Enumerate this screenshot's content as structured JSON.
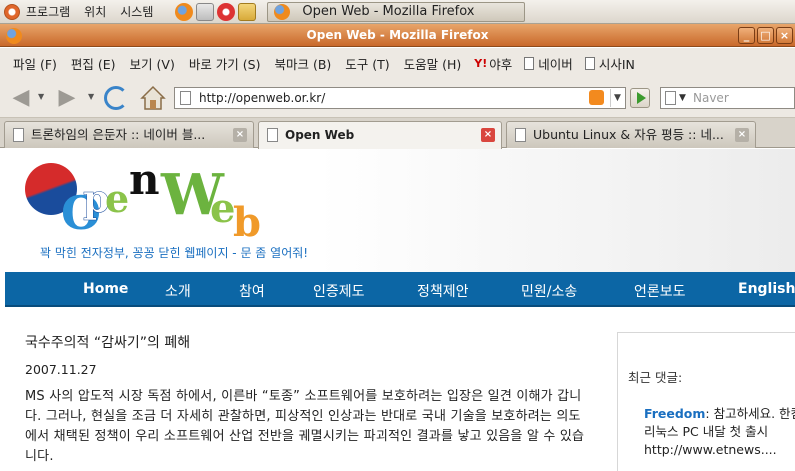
{
  "panel": {
    "menus": [
      "프로그램",
      "위치",
      "시스템"
    ],
    "task_title": "Open Web"
  },
  "window": {
    "title": "Open Web - Mozilla Firefox",
    "controls": [
      "_",
      "□",
      "×"
    ]
  },
  "menubar": {
    "items": [
      "파일 (F)",
      "편집 (E)",
      "보기 (V)",
      "바로 가기 (S)",
      "북마크 (B)",
      "도구 (T)",
      "도움말 (H)"
    ],
    "bookmarks": [
      "야후",
      "네이버",
      "시사IN"
    ]
  },
  "navbar": {
    "url": "http://openweb.or.kr/",
    "search_placeholder": "Naver"
  },
  "tabs": [
    {
      "label": "트론하임의 은둔자 :: 네이버 블..."
    },
    {
      "label": "Open Web"
    },
    {
      "label": "Ubuntu Linux & 자유 평등 :: 네..."
    }
  ],
  "site": {
    "logo_text": "OpenWeb",
    "tagline": "꽉 막힌 전자정부, 꽁꽁 닫힌 웹페이지 - 문 좀 열어줘!",
    "nav": [
      "Home",
      "소개",
      "참여",
      "인증제도",
      "정책제안",
      "민원/소송",
      "언론보도",
      "English"
    ],
    "colors": {
      "nav_bg": "#0c66a5",
      "accent": "#1a6fc0"
    }
  },
  "article": {
    "title": "국수주의적 “감싸기”의 폐해",
    "date": "2007.11.27",
    "body": "MS 사의 압도적 시장 독점 하에서, 이른바 “토종” 소프트웨어를 보호하려는 입장은 일견 이해가 갑니다. 그러나, 현실을 조금 더 자세히 관찰하면, 피상적인 인상과는 반대로 국내 기술을 보호하려는 의도에서 채택된 정책이 우리 소프트웨어 산업 전반을 궤멸시키는 파괴적인 결과를 낳고 있음을 알 수 있습니다."
  },
  "sidebar": {
    "heading": "최근 댓글:",
    "comment_author": "Freedom",
    "comment_line1": ": 참고하세요. 한컴",
    "comment_line2": "리눅스 PC 내달 첫 출시",
    "comment_line3": "http://www.etnews...."
  }
}
